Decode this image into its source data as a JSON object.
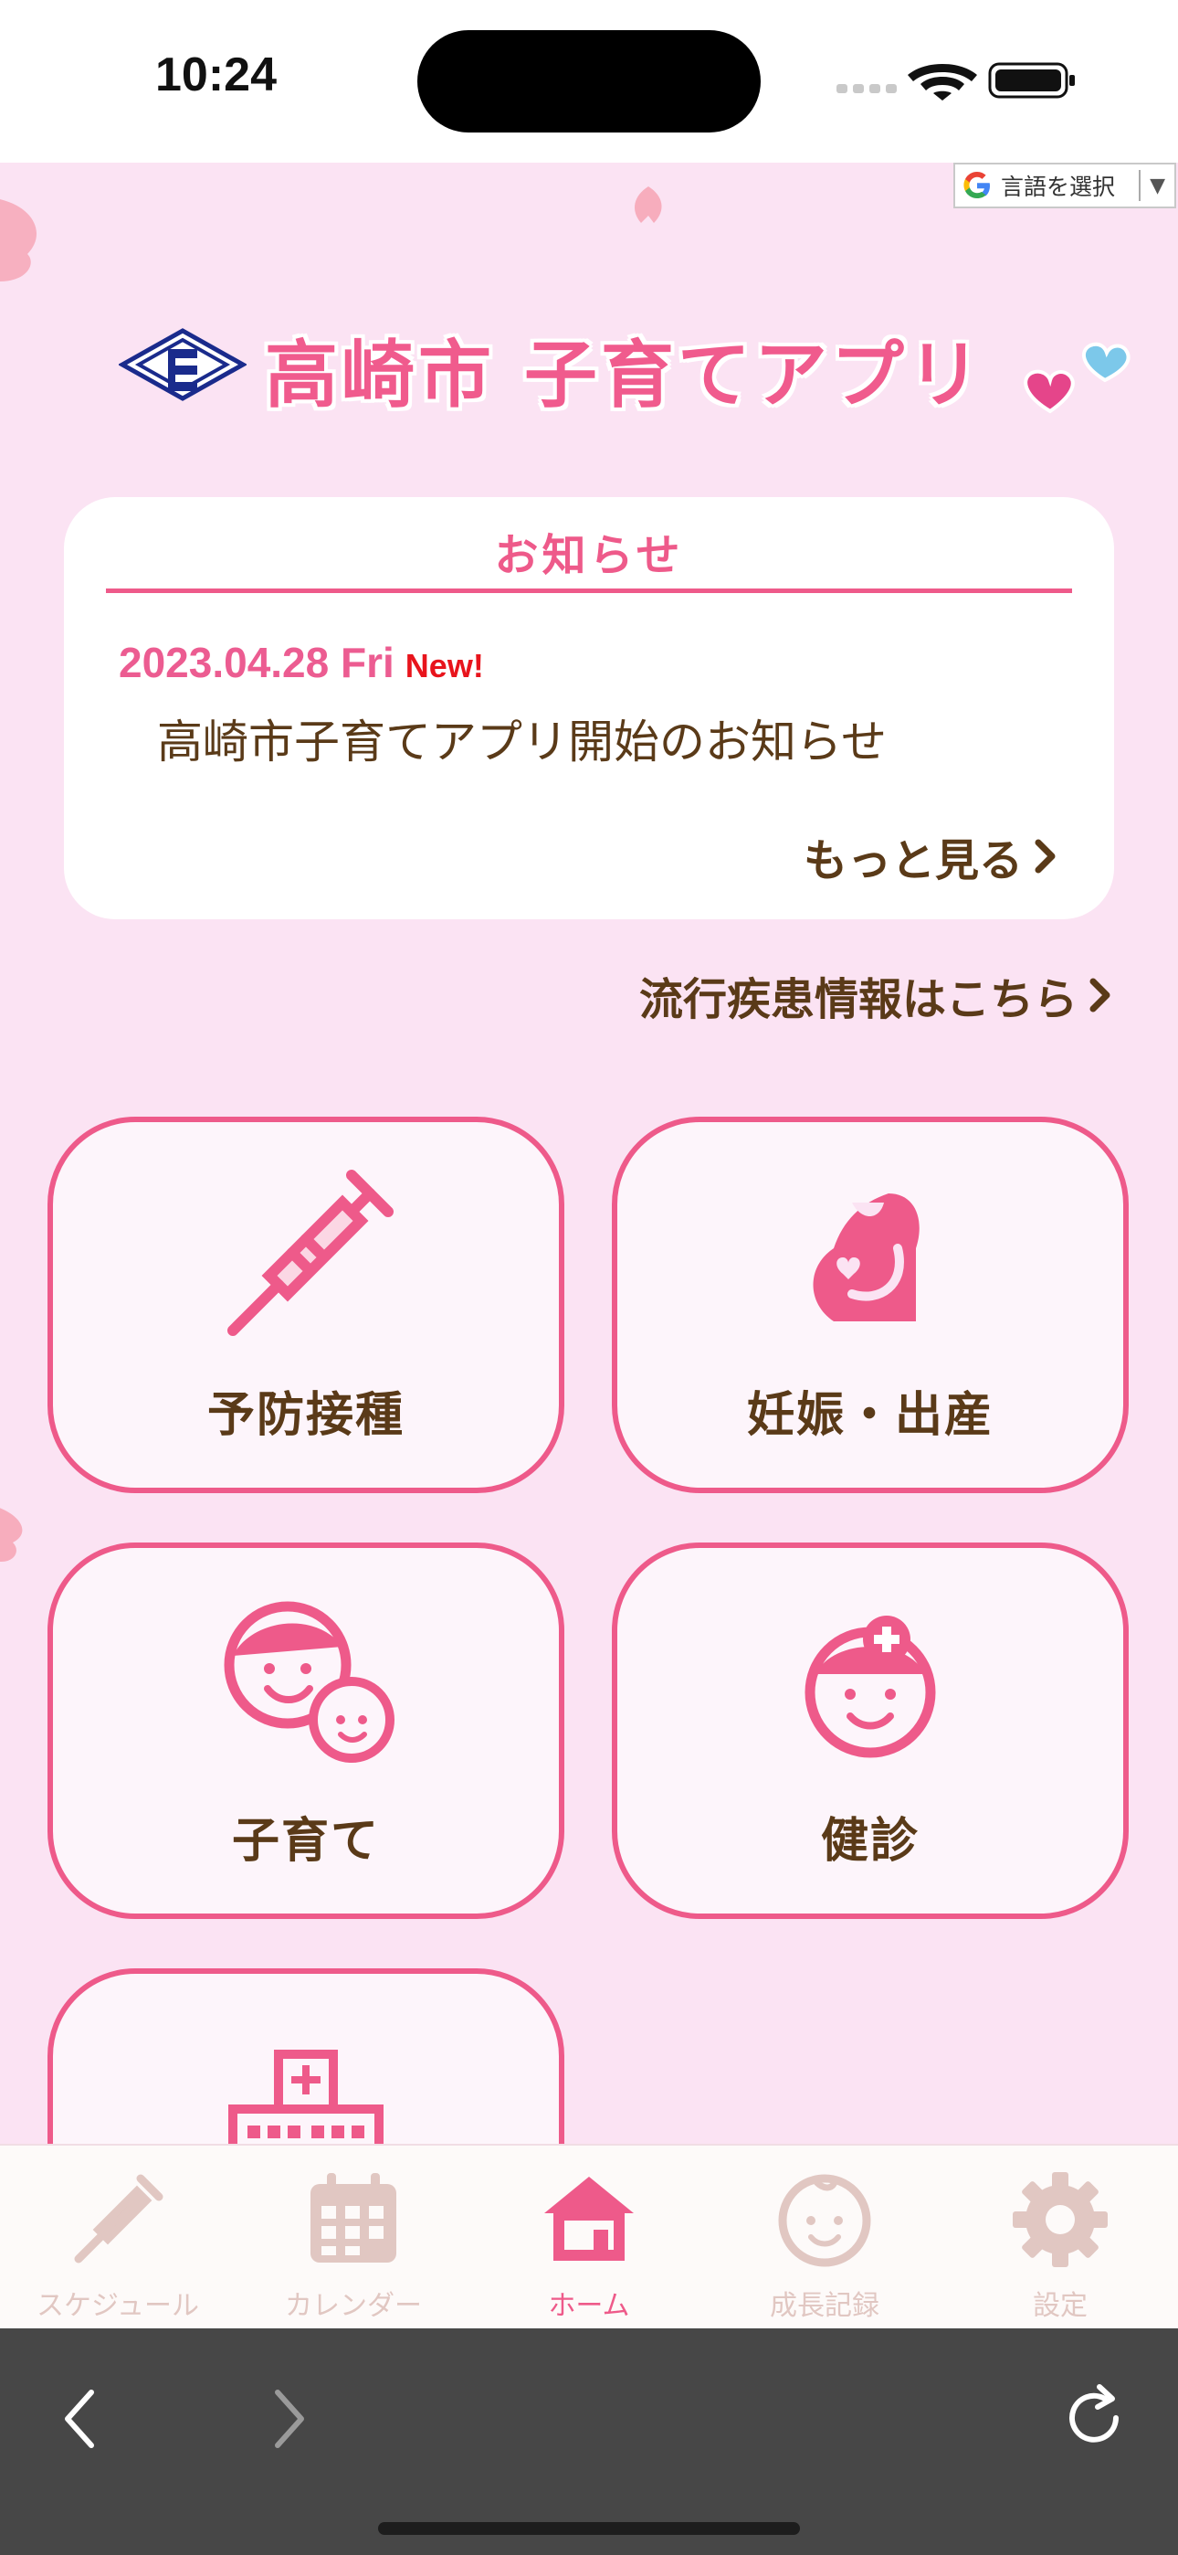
{
  "status_bar": {
    "time": "10:24"
  },
  "language_selector": {
    "label": "言語を選択",
    "arrow": "▼",
    "icon": "google-g-icon"
  },
  "header": {
    "title": "高崎市 子育てアプリ",
    "logo": "takasaki-city-emblem"
  },
  "notice": {
    "heading": "お知らせ",
    "date": "2023.04.28 Fri",
    "new_badge": "New!",
    "text": "高崎市子育てアプリ開始のお知らせ",
    "more_label": "もっと見る"
  },
  "epidemic_link": {
    "label": "流行疾患情報はこちら"
  },
  "tiles": [
    {
      "label": "予防接種",
      "icon": "syringe-icon"
    },
    {
      "label": "妊娠・出産",
      "icon": "pregnancy-icon"
    },
    {
      "label": "子育て",
      "icon": "parent-child-icon"
    },
    {
      "label": "健診",
      "icon": "checkup-icon"
    },
    {
      "label": "",
      "icon": "hospital-icon"
    }
  ],
  "tab_bar": {
    "items": [
      {
        "label": "スケジュール",
        "icon": "syringe-icon",
        "active": false
      },
      {
        "label": "カレンダー",
        "icon": "calendar-icon",
        "active": false
      },
      {
        "label": "ホーム",
        "icon": "home-icon",
        "active": true
      },
      {
        "label": "成長記録",
        "icon": "baby-face-icon",
        "active": false
      },
      {
        "label": "設定",
        "icon": "gear-icon",
        "active": false
      }
    ]
  },
  "colors": {
    "accent": "#ee5a8a",
    "background": "#fbe3f3",
    "text_brown": "#5a3a18",
    "inactive_tab": "#e1c7c2",
    "browser_bar": "#474747"
  }
}
